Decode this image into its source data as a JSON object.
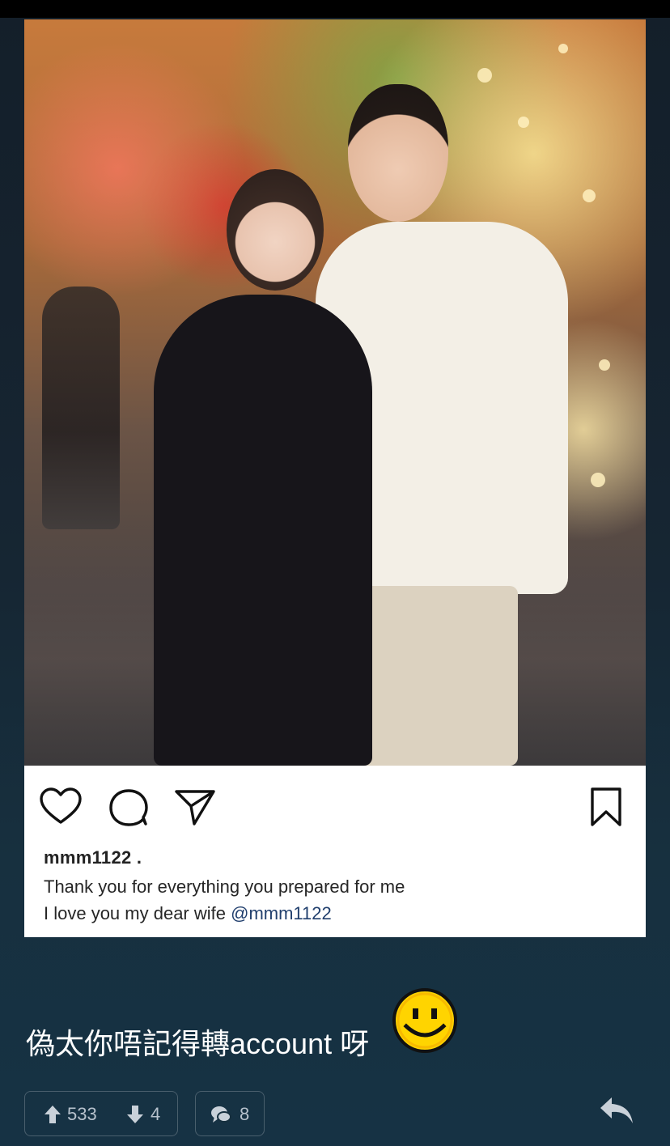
{
  "post": {
    "image": {
      "alt_name": "couple-photo"
    },
    "actions": {
      "like_icon": "heart-icon",
      "comment_icon": "comment-icon",
      "share_icon": "send-icon",
      "save_icon": "bookmark-icon"
    },
    "caption": {
      "username": "mmm1122 .",
      "line1": "Thank you for everything you prepared for me",
      "line2_prefix": "I love you my dear wife ",
      "mention": "@mmm1122"
    }
  },
  "comment_text": "偽太你唔記得轉account 呀",
  "emoji": "smiley-emoji",
  "footer": {
    "upvotes": "533",
    "downvotes": "4",
    "comments": "8",
    "upvote_icon": "arrow-up-icon",
    "downvote_icon": "arrow-down-icon",
    "comments_icon": "chat-bubbles-icon",
    "reply_icon": "reply-icon"
  },
  "colors": {
    "background_top": "#141f2a",
    "background_bottom": "#163244",
    "mention_link": "#22406e",
    "footer_text": "#b7c2cd"
  }
}
